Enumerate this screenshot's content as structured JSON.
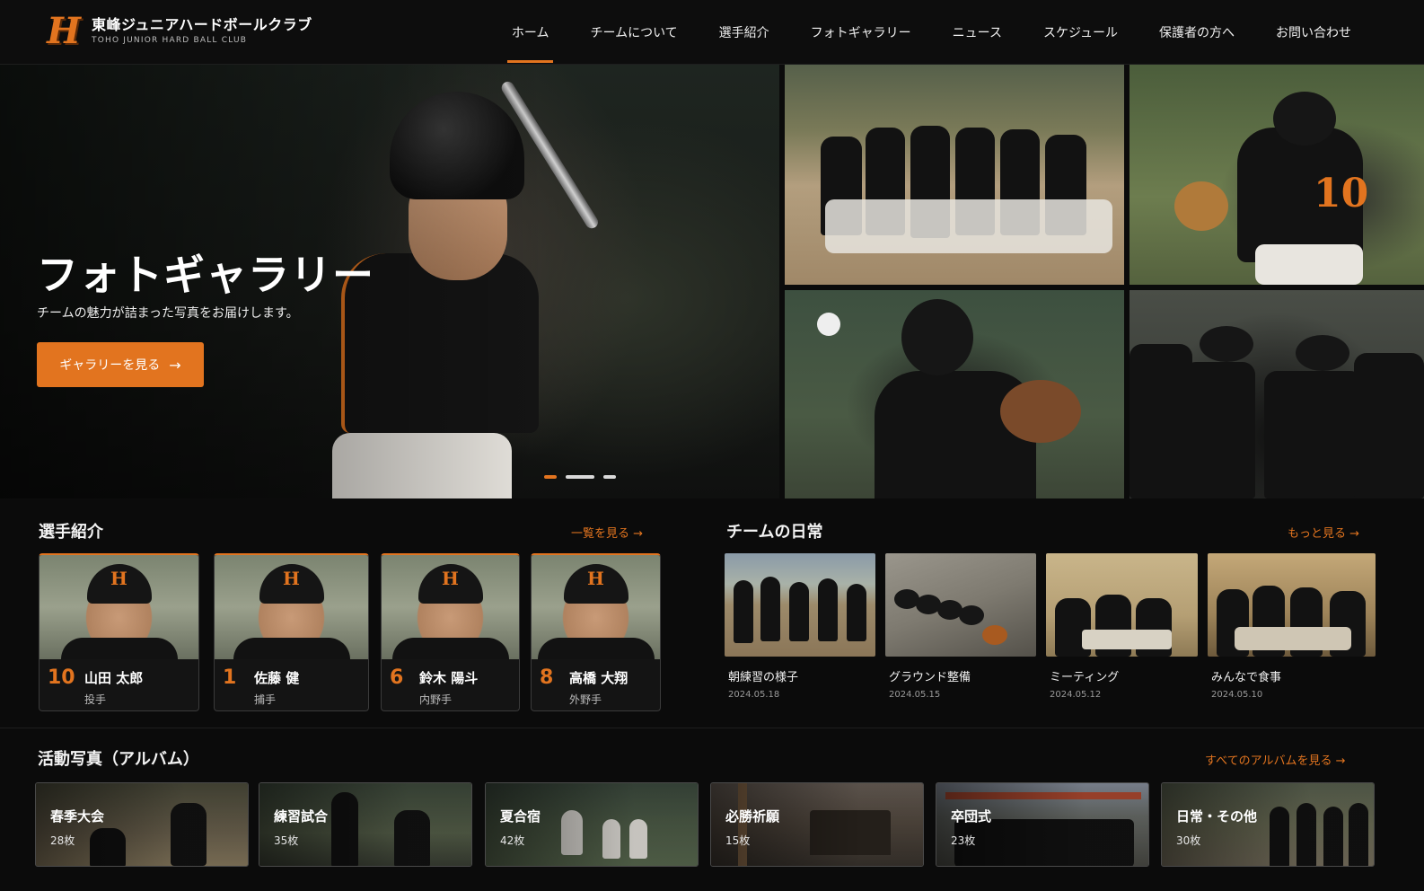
{
  "brand": {
    "logo_letter": "H",
    "name_ja": "東峰ジュニアハードボールクラブ",
    "name_en": "TOHO JUNIOR HARD BALL CLUB"
  },
  "nav": {
    "items": [
      {
        "label": "ホーム",
        "active": true
      },
      {
        "label": "チームについて"
      },
      {
        "label": "選手紹介"
      },
      {
        "label": "フォトギャラリー"
      },
      {
        "label": "ニュース"
      },
      {
        "label": "スケジュール"
      },
      {
        "label": "保護者の方へ"
      },
      {
        "label": "お問い合わせ"
      }
    ]
  },
  "hero": {
    "title": "フォトギャラリー",
    "subtitle": "チームの魅力が詰まった写真をお届けします。",
    "button_label": "ギャラリーを見る",
    "button_arrow": "→",
    "slide_count": 3,
    "active_slide": 1
  },
  "players_section": {
    "title": "選手紹介",
    "link": "一覧を見る →",
    "players": [
      {
        "number": "10",
        "name": "山田 太郎",
        "position": "投手"
      },
      {
        "number": "1",
        "name": "佐藤 健",
        "position": "捕手"
      },
      {
        "number": "6",
        "name": "鈴木 陽斗",
        "position": "内野手"
      },
      {
        "number": "8",
        "name": "高橋 大翔",
        "position": "外野手"
      }
    ]
  },
  "daily_section": {
    "title": "チームの日常",
    "link": "もっと見る →",
    "items": [
      {
        "caption": "朝練習の様子",
        "date": "2024.05.18"
      },
      {
        "caption": "グラウンド整備",
        "date": "2024.05.15"
      },
      {
        "caption": "ミーティング",
        "date": "2024.05.12"
      },
      {
        "caption": "みんなで食事",
        "date": "2024.05.10"
      }
    ]
  },
  "albums_section": {
    "title": "活動写真（アルバム）",
    "link": "すべてのアルバムを見る →",
    "albums": [
      {
        "title": "春季大会",
        "count": "28枚"
      },
      {
        "title": "練習試合",
        "count": "35枚"
      },
      {
        "title": "夏合宿",
        "count": "42枚"
      },
      {
        "title": "必勝祈願",
        "count": "15枚"
      },
      {
        "title": "卒団式",
        "count": "23枚"
      },
      {
        "title": "日常・その他",
        "count": "30枚"
      }
    ]
  },
  "colors": {
    "accent": "#e2741f",
    "background": "#0b0b0b",
    "header": "#0d0d0d"
  }
}
